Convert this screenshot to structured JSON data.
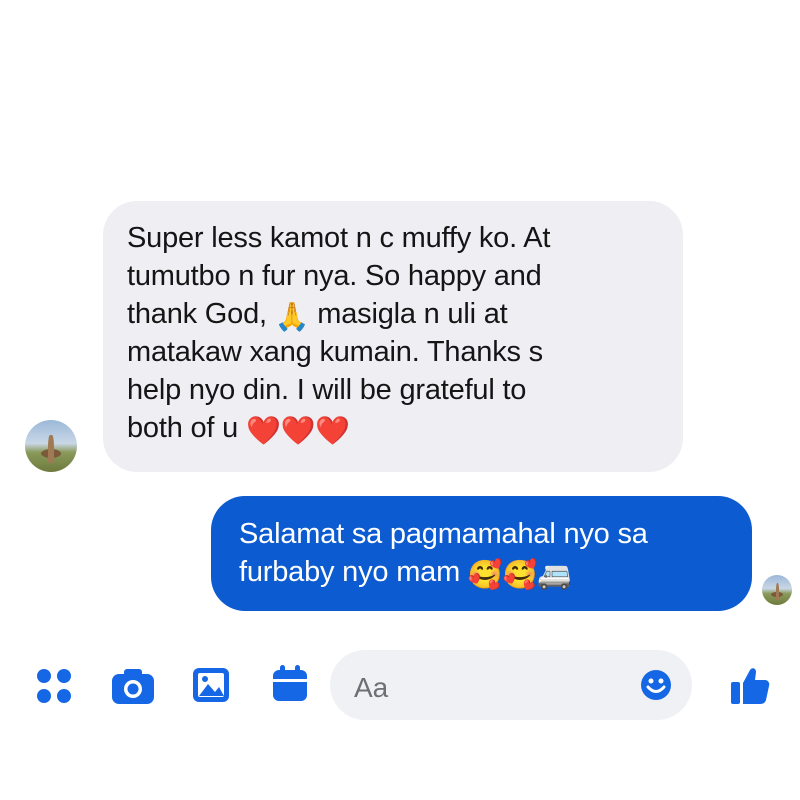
{
  "thread": {
    "incoming": {
      "lines": [
        "Super less kamot n c muffy ko. At",
        "tumutbo n fur  nya. So happy and",
        "thank God,",
        " masigla n uli at",
        "matakaw xang kumain. Thanks s",
        "help nyo din. I will be grateful to",
        "both of u"
      ],
      "emoji_pray": "🙏",
      "emoji_hearts": "❤️❤️❤️"
    },
    "outgoing": {
      "lines": [
        "Salamat sa pagmamahal nyo sa",
        "furbaby nyo mam"
      ],
      "emoji": "🥰🥰🚐"
    }
  },
  "composer": {
    "placeholder": "Aa",
    "icons": [
      "apps-icon",
      "camera-icon",
      "gallery-icon",
      "calendar-icon",
      "emoji-icon",
      "thumbs-up-icon"
    ]
  },
  "colors": {
    "accent": "#1667e6",
    "outgoing_bubble": "#0d5bd0",
    "incoming_bubble": "#eeeef3",
    "heart": "#e8132b"
  }
}
